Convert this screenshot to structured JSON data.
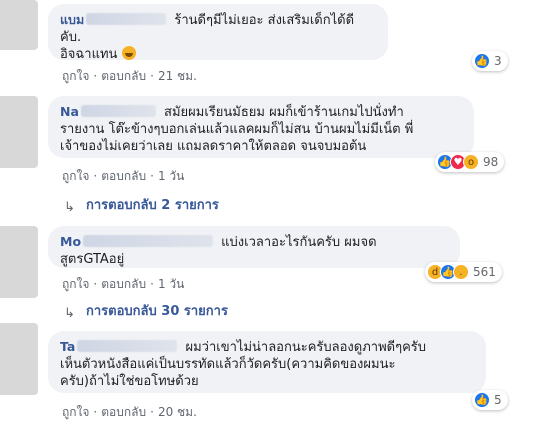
{
  "comments": [
    {
      "author": "แบม",
      "text_line1": "ร้านดีๆมีไม่เยอะ ส่งเสริมเด็กได้ดี คับ.",
      "text_line2": "อิจฉาแทน",
      "actions": {
        "like": "ถูกใจ",
        "reply": "ตอบกลับ",
        "time": "21 ชม."
      },
      "reaction_count": "3",
      "reaction_icons": [
        "like-icon"
      ]
    },
    {
      "author": "Na",
      "text_line1": "สมัยผมเรียนมัธยม ผมก็เข้าร้านเกมไปนั่งทำ",
      "text_line2": "รายงาน โต๊ะข้างๆบอกเล่นแล้วแลคผมก็ไม่สน บ้านผมไม่มีเน็ต พี่",
      "text_line3": "เจ้าของไม่เคยว่าเลย แถมลดราคาให้ตลอด จนจบมอต้น",
      "actions": {
        "like": "ถูกใจ",
        "reply": "ตอบกลับ",
        "time": "1 วัน"
      },
      "reaction_count": "98",
      "reaction_icons": [
        "like-icon",
        "love-icon",
        "wow-icon"
      ],
      "replies": "การตอบกลับ 2 รายการ"
    },
    {
      "author": "Mo",
      "text_line1": "แบ่งเวลาอะไรกันครับ ผมจด",
      "text_line2": "สูตรGTAอยู่",
      "actions": {
        "like": "ถูกใจ",
        "reply": "ตอบกลับ",
        "time": "1 วัน"
      },
      "reaction_count": "561",
      "reaction_icons": [
        "haha-icon",
        "like-icon",
        "sad-icon"
      ],
      "replies": "การตอบกลับ 30 รายการ"
    },
    {
      "author": "Ta",
      "text_line1": "ผมว่าเขาไม่น่าลอกนะครับลองดูภาพดีๆครับ",
      "text_line2": "เห็นตัวหนังสือแค่เป็นบรรทัดแล้วก็วัดครับ(ความคิดของผมนะ",
      "text_line3": "ครับ)ถ้าไม่ใช่ขอโทษด้วย",
      "actions": {
        "like": "ถูกใจ",
        "reply": "ตอบกลับ",
        "time": "20 ชม."
      },
      "reaction_count": "5",
      "reaction_icons": [
        "like-icon"
      ]
    }
  ]
}
